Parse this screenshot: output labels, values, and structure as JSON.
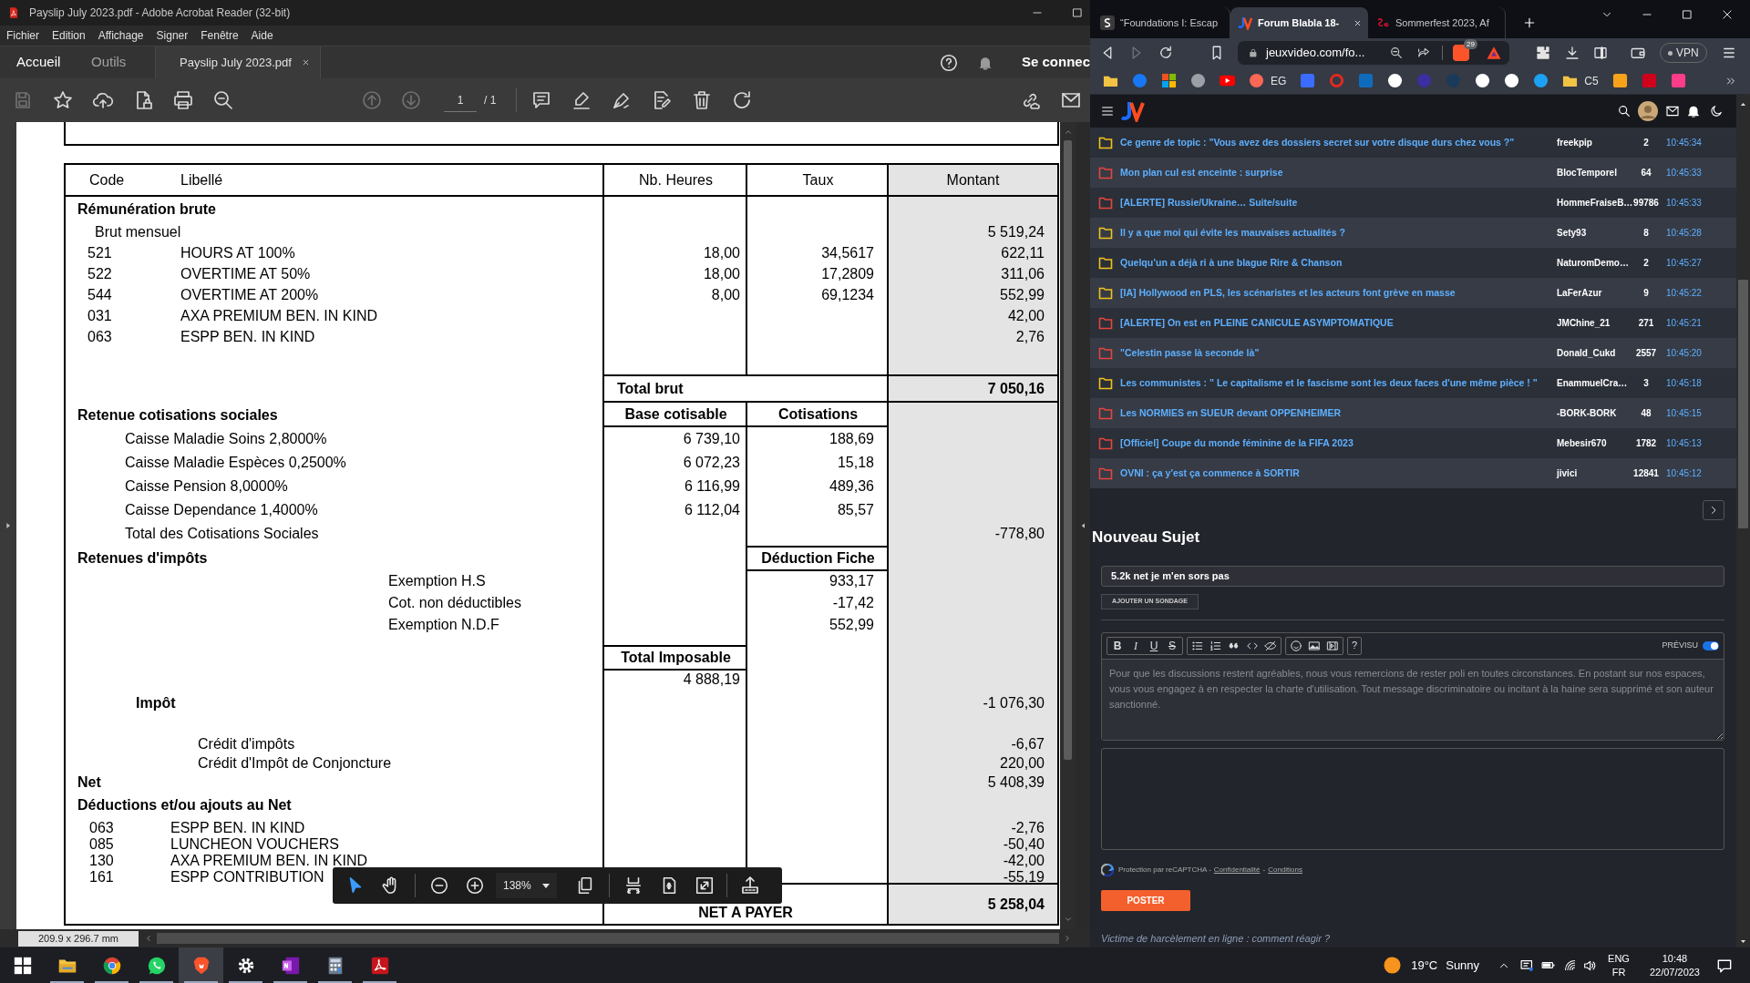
{
  "acrobat": {
    "title": "Payslip July 2023.pdf - Adobe Acrobat Reader (32-bit)",
    "menu": [
      "Fichier",
      "Edition",
      "Affichage",
      "Signer",
      "Fenêtre",
      "Aide"
    ],
    "nav_tabs": [
      {
        "label": "Accueil",
        "selected": true
      },
      {
        "label": "Outils",
        "selected": false
      }
    ],
    "doc_tab": {
      "label": "Payslip July 2023.pdf",
      "selected": true
    },
    "sign_in": "Se connec",
    "toolbar": [
      {
        "kind": "save",
        "disabled": true
      },
      {
        "kind": "star",
        "disabled": false
      },
      {
        "kind": "upload",
        "disabled": false
      },
      {
        "kind": "lock",
        "disabled": false
      },
      {
        "kind": "print",
        "disabled": false
      },
      {
        "kind": "search",
        "disabled": false
      },
      {
        "kind": "up",
        "disabled": true
      },
      {
        "kind": "down",
        "disabled": true
      }
    ],
    "page": {
      "current": "1",
      "total": "/ 1"
    },
    "page_size": "209.9 x 296.7 mm",
    "float_toolbar": {
      "tools": [
        {
          "kind": "select",
          "selected": true
        },
        {
          "kind": "hand",
          "selected": false
        }
      ],
      "zoom": "138%"
    }
  },
  "payslip": {
    "columns": [
      "Code",
      "Libellé",
      "Nb. Heures",
      "Taux",
      "Montant"
    ],
    "rows": [
      {
        "kind": "section",
        "label": "Rémunération brute"
      },
      {
        "kind": "sub",
        "label": "Brut mensuel",
        "amount": "5 519,24"
      },
      {
        "kind": "item",
        "code": "521",
        "label": "HOURS AT 100%",
        "hours": "18,00",
        "rate": "34,5617",
        "amount": "622,11"
      },
      {
        "kind": "item",
        "code": "522",
        "label": "OVERTIME AT 50%",
        "hours": "18,00",
        "rate": "17,2809",
        "amount": "311,06"
      },
      {
        "kind": "item",
        "code": "544",
        "label": "OVERTIME AT 200%",
        "hours": "8,00",
        "rate": "69,1234",
        "amount": "552,99"
      },
      {
        "kind": "item",
        "code": "031",
        "label": "AXA PREMIUM BEN. IN KIND",
        "amount": "42,00"
      },
      {
        "kind": "item",
        "code": "063",
        "label": "ESPP BEN. IN KIND",
        "amount": "2,76"
      },
      {
        "kind": "total",
        "total_label": "Total brut",
        "amount": "7 050,16"
      },
      {
        "kind": "section",
        "label": "Retenue cotisations sociales",
        "base": "Base cotisable",
        "contribution": "Cotisations"
      },
      {
        "kind": "contribution",
        "label": "Caisse Maladie Soins 2,8000%",
        "base": "6 739,10",
        "contribution": "188,69"
      },
      {
        "kind": "contribution",
        "label": "Caisse Maladie Espèces 0,2500%",
        "base": "6 072,23",
        "contribution": "15,18"
      },
      {
        "kind": "contribution",
        "label": "Caisse Pension 8,0000%",
        "base": "6 116,99",
        "contribution": "489,36"
      },
      {
        "kind": "contribution",
        "label": "Caisse Dependance 1,4000%",
        "base": "6 112,04",
        "contribution": "85,57"
      },
      {
        "kind": "contribution",
        "label": "Total des Cotisations Sociales",
        "amount": "-778,80"
      },
      {
        "kind": "section",
        "label": "Retenues d'impôts",
        "deduction": "Déduction Fiche"
      },
      {
        "kind": "tax_line",
        "label": "Exemption H.S",
        "deduction": "933,17"
      },
      {
        "kind": "tax_line",
        "label": "Cot. non déductibles",
        "deduction": "-17,42"
      },
      {
        "kind": "tax_line",
        "label": "Exemption N.D.F",
        "deduction": "552,99"
      },
      {
        "kind": "taxable_head",
        "taxable": "Total Imposable"
      },
      {
        "kind": "taxable",
        "taxable": "4 888,19"
      },
      {
        "kind": "tax",
        "label": "Impôt",
        "amount": "-1 076,30"
      },
      {
        "kind": "credit",
        "label": "Crédit d'impôts",
        "amount": "-6,67"
      },
      {
        "kind": "credit",
        "label": "Crédit d'Impôt de Conjoncture",
        "amount": "220,00"
      },
      {
        "kind": "net",
        "label": "Net",
        "amount": "5 408,39"
      },
      {
        "kind": "section",
        "label": "Déductions et/ou ajouts au Net"
      },
      {
        "kind": "net_item",
        "code": "063",
        "label": "ESPP BEN. IN KIND",
        "amount": "-2,76"
      },
      {
        "kind": "net_item",
        "code": "085",
        "label": "LUNCHEON VOUCHERS",
        "amount": "-50,40"
      },
      {
        "kind": "net_item",
        "code": "130",
        "label": "AXA PREMIUM BEN. IN KIND",
        "amount": "-42,00"
      },
      {
        "kind": "net_item",
        "code": "161",
        "label": "ESPP CONTRIBUTION",
        "amount": "-55,19"
      },
      {
        "kind": "final",
        "total_label": "NET A PAYER",
        "amount": "5 258,04"
      }
    ]
  },
  "browser": {
    "tabs": [
      {
        "kind": "letter",
        "title": "“Foundations I: Escap",
        "selected": false
      },
      {
        "kind": "jv",
        "title": "Forum Blabla 18-",
        "selected": true
      },
      {
        "kind": "red",
        "title": "Sommerfest 2023, Af",
        "selected": false
      }
    ],
    "nav": [
      {
        "kind": "back",
        "disabled": false
      },
      {
        "kind": "forward",
        "disabled": true
      },
      {
        "kind": "reload",
        "disabled": false
      }
    ],
    "url": "jeuxvideo.com/fo...",
    "shield_count": "29",
    "vpn": "VPN",
    "bookmarks": [
      {
        "kind": "folder"
      },
      {
        "kind": "round",
        "color": "#1877f2"
      },
      {
        "kind": "tiles"
      },
      {
        "kind": "round",
        "color": "#9aa0a6"
      },
      {
        "kind": "play",
        "color": "#ff0000"
      },
      {
        "kind": "round",
        "color": "#f96854",
        "label": "EG"
      },
      {
        "kind": "square",
        "color": "#3b6cff"
      },
      {
        "kind": "ring",
        "color": "#e8281e"
      },
      {
        "kind": "square",
        "color": "#0f6cbd"
      },
      {
        "kind": "round",
        "color": "#ffffff"
      },
      {
        "kind": "round",
        "color": "#3a2fa0"
      },
      {
        "kind": "round",
        "color": "#1b3a5a"
      },
      {
        "kind": "round",
        "color": "#ffffff"
      },
      {
        "kind": "round",
        "color": "#ffffff"
      },
      {
        "kind": "round",
        "color": "#1da1f2"
      },
      {
        "kind": "folder",
        "label": "C5"
      },
      {
        "kind": "square",
        "color": "#f7a21b"
      },
      {
        "kind": "square",
        "color": "#d0021b"
      },
      {
        "kind": "square",
        "color": "#ff3c8a"
      }
    ]
  },
  "forum": {
    "topics": [
      {
        "color": "#f2c21b",
        "title": "Ce genre de topic : \"Vous avez des dossiers secret sur votre disque durs chez vous ?\"",
        "author": "freekpip",
        "count": "2",
        "time": "10:45:34"
      },
      {
        "color": "#e8453c",
        "title": "Mon plan cul est enceinte : surprise",
        "author": "BlocTemporel",
        "count": "64",
        "time": "10:45:33"
      },
      {
        "color": "#e8453c",
        "title": "[ALERTE] Russie/Ukraine… Suite/suite",
        "author": "HommeFraiseB…",
        "count": "99786",
        "time": "10:45:33"
      },
      {
        "color": "#f2c21b",
        "title": "Il y a que moi qui évite les mauvaises actualités ?",
        "author": "Sety93",
        "count": "8",
        "time": "10:45:28"
      },
      {
        "color": "#f2c21b",
        "title": "Quelqu’un a déjà ri à une blague Rire & Chanson",
        "author": "NaturomDemo…",
        "count": "2",
        "time": "10:45:27"
      },
      {
        "color": "#f2c21b",
        "title": "[IA] Hollywood en PLS, les scénaristes et les acteurs font grève en masse",
        "author": "LaFerAzur",
        "count": "9",
        "time": "10:45:22"
      },
      {
        "color": "#e8453c",
        "title": "[ALERTE] On est en PLEINE CANICULE ASYMPTOMATIQUE",
        "author": "JMChine_21",
        "count": "271",
        "time": "10:45:21"
      },
      {
        "color": "#e8453c",
        "title": "\"Celestin passe là seconde là\"",
        "author": "Donald_Cukd",
        "count": "2557",
        "time": "10:45:20"
      },
      {
        "color": "#f2c21b",
        "title": "Les communistes : \" Le capitalisme et le fascisme sont les deux faces d'une même pièce ! \"",
        "author": "EnammuelCra…",
        "count": "3",
        "time": "10:45:18"
      },
      {
        "color": "#e8453c",
        "title": "Les NORMIES en SUEUR devant OPPENHEIMER",
        "author": "-BORK-BORK",
        "count": "48",
        "time": "10:45:15"
      },
      {
        "color": "#e8453c",
        "title": "[Officiel] Coupe du monde féminine de la FIFA 2023",
        "author": "Mebesir670",
        "count": "1782",
        "time": "10:45:13"
      },
      {
        "color": "#e8453c",
        "title": "OVNI : ça y'est ça commence à SORTIR",
        "author": "jivici",
        "count": "12841",
        "time": "10:45:12"
      }
    ],
    "new_topic": {
      "heading": "Nouveau Sujet",
      "subject": "5.2k net je m'en sors pas",
      "poll_button": "AJOUTER UN SONDAGE",
      "format_buttons": [
        "B",
        "I",
        "U",
        "S"
      ],
      "help": "?",
      "preview": {
        "label": "PRÉVISU",
        "on": true
      },
      "placeholder": "Pour que les discussions restent agréables, nous vous remercions de rester poli en toutes circonstances. En postant sur nos espaces, vous vous engagez à en respecter la charte d'utilisation. Tout message discriminatoire ou incitant à la haine sera supprimé et son auteur sanctionné.",
      "captcha": {
        "text": "Protection par reCAPTCHA -",
        "links": [
          "Confidentialité",
          "Conditions"
        ],
        "separator": "-"
      },
      "submit": "POSTER",
      "footer_link": "Victime de harcèlement en ligne : comment réagir ?"
    }
  },
  "taskbar": {
    "apps": [
      {
        "kind": "start",
        "running": false,
        "selected": false
      },
      {
        "kind": "explorer",
        "running": true,
        "selected": false
      },
      {
        "kind": "chrome",
        "running": true,
        "selected": false
      },
      {
        "kind": "whatsapp",
        "running": true,
        "selected": false
      },
      {
        "kind": "brave",
        "running": true,
        "selected": true
      },
      {
        "kind": "settings",
        "running": true,
        "selected": false
      },
      {
        "kind": "onenote",
        "running": true,
        "selected": false
      },
      {
        "kind": "calculator",
        "running": true,
        "selected": false
      },
      {
        "kind": "acrobat",
        "running": true,
        "selected": false
      }
    ],
    "temperature": "19°C",
    "weather": "Sunny",
    "languages": [
      "ENG",
      "FR"
    ],
    "time": "10:48",
    "date": "22/07/2023"
  }
}
